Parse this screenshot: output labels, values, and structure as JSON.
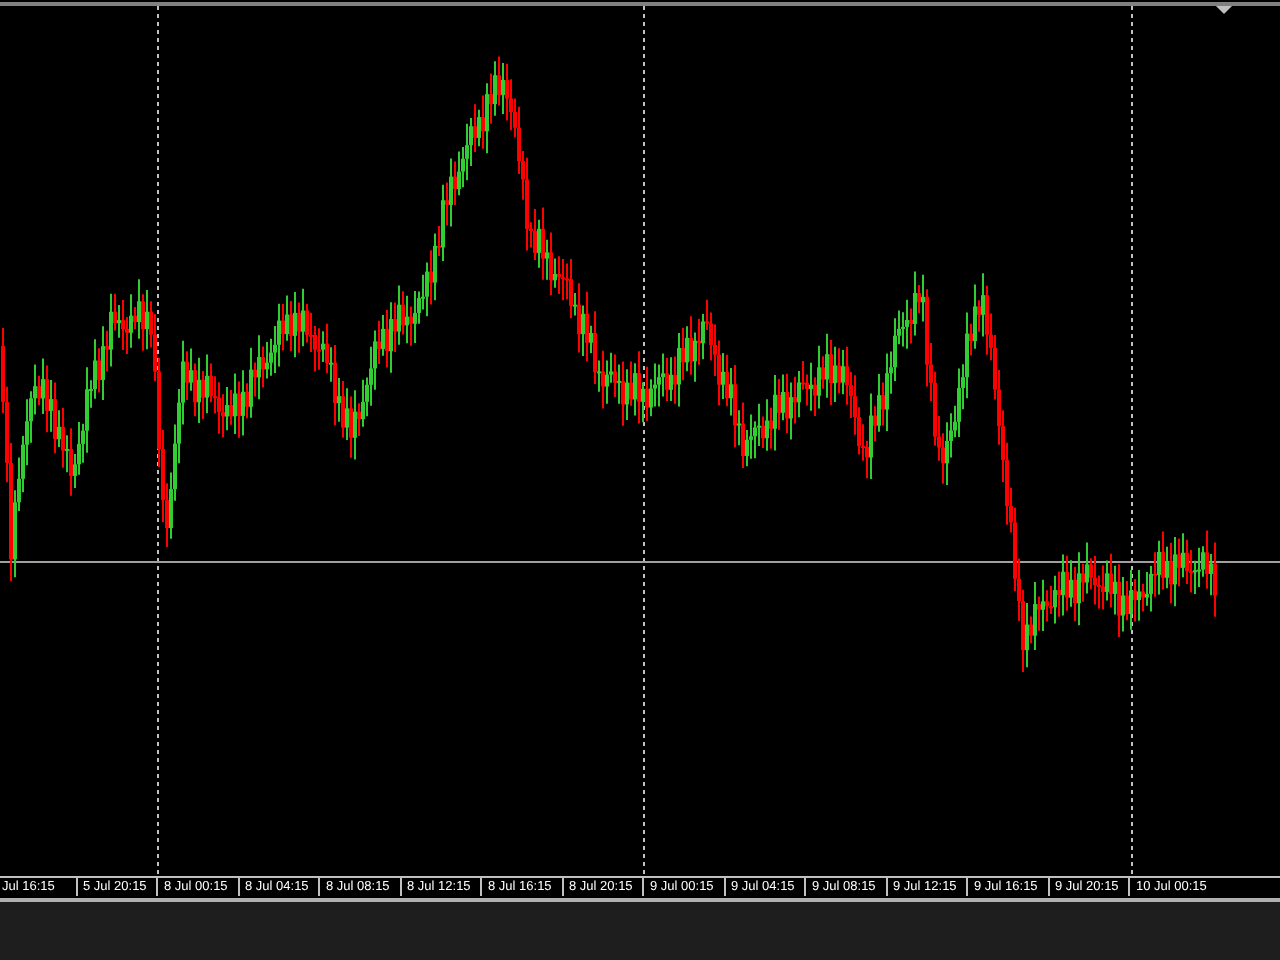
{
  "time_axis": {
    "labels": [
      "Jul 16:15",
      "5 Jul 20:15",
      "8 Jul 00:15",
      "8 Jul 04:15",
      "8 Jul 08:15",
      "8 Jul 12:15",
      "8 Jul 16:15",
      "8 Jul 20:15",
      "9 Jul 00:15",
      "9 Jul 04:15",
      "9 Jul 08:15",
      "9 Jul 12:15",
      "9 Jul 16:15",
      "9 Jul 20:15",
      "10 Jul 00:15"
    ]
  }
}
